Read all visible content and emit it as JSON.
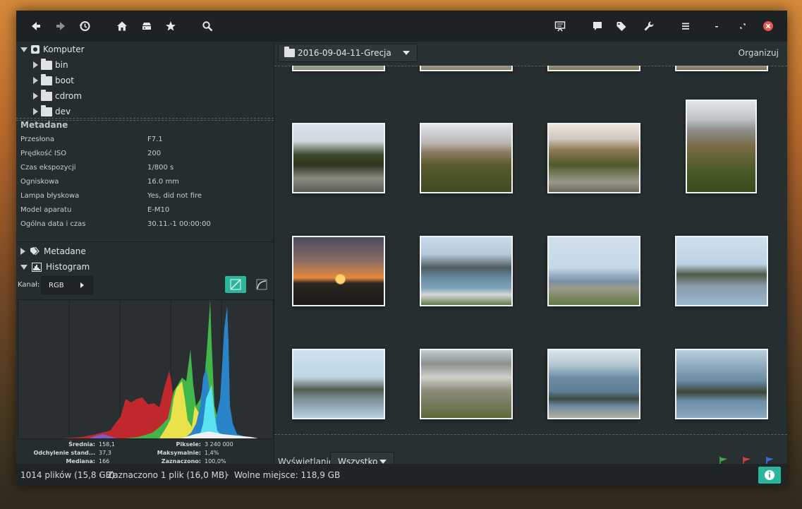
{
  "sidebar": {
    "tree": [
      {
        "label": "Komputer"
      },
      {
        "label": "bin"
      },
      {
        "label": "boot"
      },
      {
        "label": "cdrom"
      },
      {
        "label": "dev"
      }
    ]
  },
  "metadata": {
    "title": "Metadane",
    "rows": [
      {
        "key": "Przesłona",
        "value": "F7.1"
      },
      {
        "key": "Prędkość ISO",
        "value": "200"
      },
      {
        "key": "Czas ekspozycji",
        "value": "1/800 s"
      },
      {
        "key": "Ogniskowa",
        "value": "16.0 mm"
      },
      {
        "key": "Lampa błyskowa",
        "value": "Yes, did not fire"
      },
      {
        "key": "Model aparatu",
        "value": "E-M10"
      },
      {
        "key": "Ogólna data i czas",
        "value": "30.11.-1 00:00:00"
      }
    ]
  },
  "sections": {
    "metadata_label": "Metadane",
    "histogram_label": "Histogram"
  },
  "histogram": {
    "channel_label": "Kanał:",
    "channel_value": "RGB",
    "stats": {
      "mean_label": "Średnia:",
      "mean_value": "158,1",
      "std_label": "Odchylenie stand...",
      "std_value": "37,3",
      "median_label": "Mediana:",
      "median_value": "166",
      "pixels_label": "Piksele:",
      "pixels_value": "3 240 000",
      "max_label": "Maksymalnie:",
      "max_value": "1,4%",
      "selected_label": "Zaznaczono:",
      "selected_value": "100,0%"
    }
  },
  "browser": {
    "folder": "2016-09-04-11-Grecja",
    "organize_label": "Organizuj",
    "view_label": "Wyświetlanie:",
    "view_value": "Wszystko"
  },
  "status": {
    "files": "1014 plików (15,8 GB)",
    "selected": "Zaznaczono 1 plik (16,0 MB)",
    "free": "Wolne miejsce: 118,9 GB"
  },
  "colors": {
    "accent": "#2bb59a",
    "flag_green": "#3fae49",
    "flag_red": "#d8403a",
    "flag_blue": "#3a6fd8"
  },
  "icons": [
    "back-icon",
    "forward-icon",
    "history-icon",
    "home-icon",
    "drive-icon",
    "star-icon",
    "search-icon",
    "slideshow-icon",
    "comment-icon",
    "tag-icon",
    "wrench-icon",
    "menu-icon",
    "minimize-icon",
    "restore-icon",
    "close-icon"
  ]
}
